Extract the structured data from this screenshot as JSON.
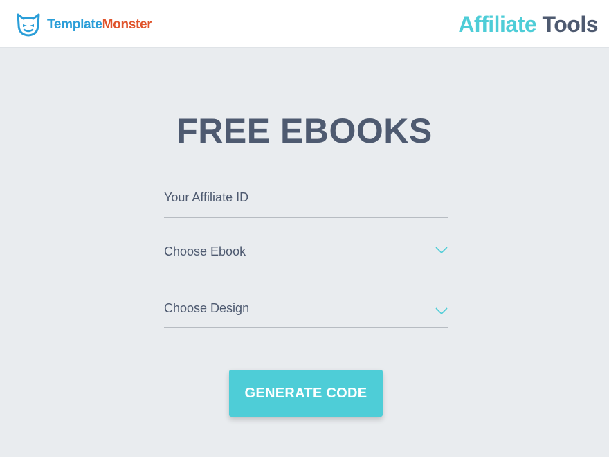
{
  "header": {
    "logo_part1": "Template",
    "logo_part2": "Monster",
    "tools_part1": "Affiliate",
    "tools_part2": "Tools"
  },
  "main": {
    "title": "FREE EBOOKS",
    "affiliate_label": "Your Affiliate ID",
    "ebook_label": "Choose Ebook",
    "design_label": "Choose Design",
    "button_label": "GENERATE CODE"
  },
  "icons": {
    "logo": "monster-logo-icon",
    "dropdown": "chevron-down-icon"
  },
  "colors": {
    "accent": "#4ecdd7",
    "text": "#4e5a70",
    "logo_blue": "#2a9ed8",
    "logo_orange": "#e0542c",
    "background": "#e9ecef"
  }
}
